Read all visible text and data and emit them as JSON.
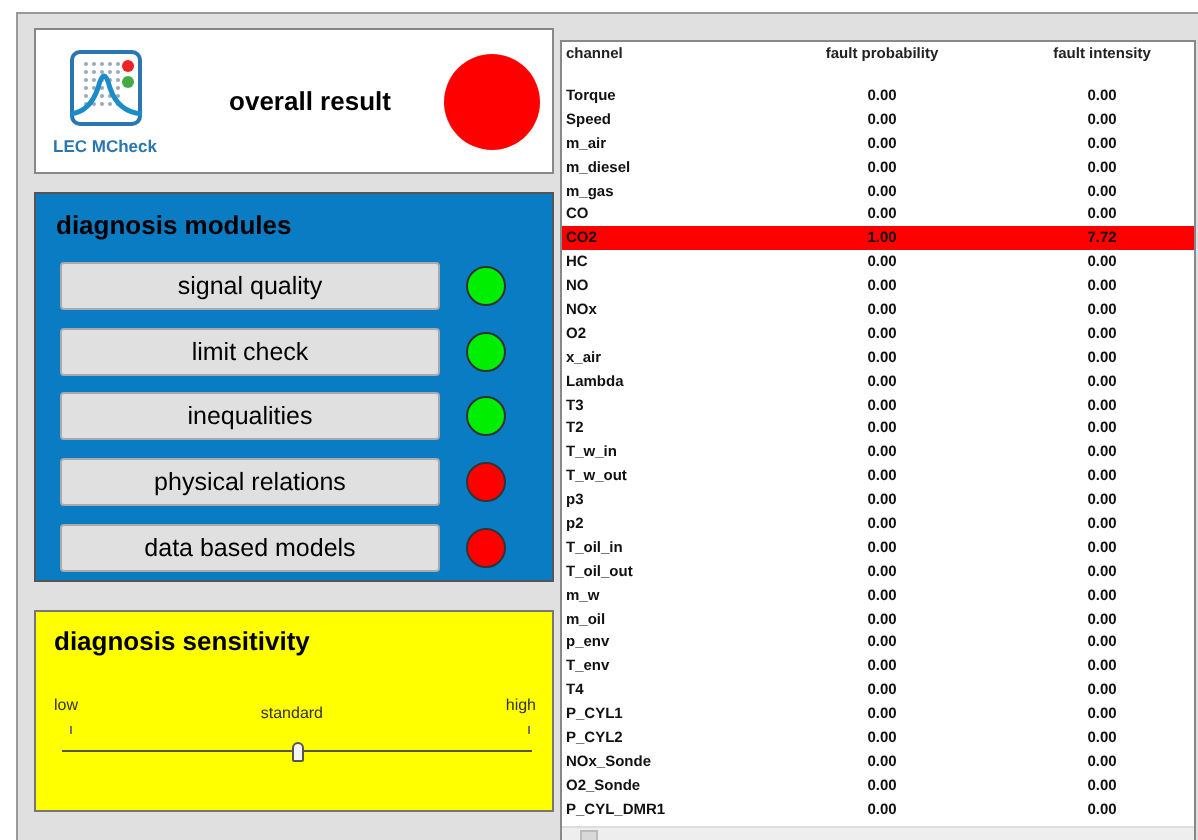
{
  "logo": {
    "text": "LEC MCheck"
  },
  "overall": {
    "label": "overall result",
    "color": "#ff0000"
  },
  "modules": {
    "title": "diagnosis modules",
    "items": [
      {
        "label": "signal quality",
        "color": "#00ee00"
      },
      {
        "label": "limit check",
        "color": "#00ee00"
      },
      {
        "label": "inequalities",
        "color": "#00ee00"
      },
      {
        "label": "physical relations",
        "color": "#ff0000"
      },
      {
        "label": "data based models",
        "color": "#ff0000"
      }
    ]
  },
  "sensitivity": {
    "title": "diagnosis sensitivity",
    "low": "low",
    "standard": "standard",
    "high": "high",
    "level": 0.5
  },
  "table": {
    "columns": [
      "channel",
      "fault probability",
      "fault intensity"
    ],
    "rows": [
      {
        "cells": [
          "Torque",
          "0.00",
          "0.00"
        ],
        "fault": false
      },
      {
        "cells": [
          "Speed",
          "0.00",
          "0.00"
        ],
        "fault": false
      },
      {
        "cells": [
          "m_air",
          "0.00",
          "0.00"
        ],
        "fault": false
      },
      {
        "cells": [
          "m_diesel",
          "0.00",
          "0.00"
        ],
        "fault": false
      },
      {
        "cells": [
          "m_gas",
          "0.00",
          "0.00"
        ],
        "fault": false
      },
      {
        "cells": [
          "CO",
          "0.00",
          "0.00"
        ],
        "fault": false
      },
      {
        "cells": [
          "CO2",
          "1.00",
          "7.72"
        ],
        "fault": true
      },
      {
        "cells": [
          "HC",
          "0.00",
          "0.00"
        ],
        "fault": false
      },
      {
        "cells": [
          "NO",
          "0.00",
          "0.00"
        ],
        "fault": false
      },
      {
        "cells": [
          "NOx",
          "0.00",
          "0.00"
        ],
        "fault": false
      },
      {
        "cells": [
          "O2",
          "0.00",
          "0.00"
        ],
        "fault": false
      },
      {
        "cells": [
          "x_air",
          "0.00",
          "0.00"
        ],
        "fault": false
      },
      {
        "cells": [
          "Lambda",
          "0.00",
          "0.00"
        ],
        "fault": false
      },
      {
        "cells": [
          "T3",
          "0.00",
          "0.00"
        ],
        "fault": false
      },
      {
        "cells": [
          "T2",
          "0.00",
          "0.00"
        ],
        "fault": false
      },
      {
        "cells": [
          "T_w_in",
          "0.00",
          "0.00"
        ],
        "fault": false
      },
      {
        "cells": [
          "T_w_out",
          "0.00",
          "0.00"
        ],
        "fault": false
      },
      {
        "cells": [
          "p3",
          "0.00",
          "0.00"
        ],
        "fault": false
      },
      {
        "cells": [
          "p2",
          "0.00",
          "0.00"
        ],
        "fault": false
      },
      {
        "cells": [
          "T_oil_in",
          "0.00",
          "0.00"
        ],
        "fault": false
      },
      {
        "cells": [
          "T_oil_out",
          "0.00",
          "0.00"
        ],
        "fault": false
      },
      {
        "cells": [
          "m_w",
          "0.00",
          "0.00"
        ],
        "fault": false
      },
      {
        "cells": [
          "m_oil",
          "0.00",
          "0.00"
        ],
        "fault": false
      },
      {
        "cells": [
          "p_env",
          "0.00",
          "0.00"
        ],
        "fault": false
      },
      {
        "cells": [
          "T_env",
          "0.00",
          "0.00"
        ],
        "fault": false
      },
      {
        "cells": [
          "T4",
          "0.00",
          "0.00"
        ],
        "fault": false
      },
      {
        "cells": [
          "P_CYL1",
          "0.00",
          "0.00"
        ],
        "fault": false
      },
      {
        "cells": [
          "P_CYL2",
          "0.00",
          "0.00"
        ],
        "fault": false
      },
      {
        "cells": [
          "NOx_Sonde",
          "0.00",
          "0.00"
        ],
        "fault": false
      },
      {
        "cells": [
          "O2_Sonde",
          "0.00",
          "0.00"
        ],
        "fault": false
      },
      {
        "cells": [
          "P_CYL_DMR1",
          "0.00",
          "0.00"
        ],
        "fault": false
      }
    ]
  }
}
